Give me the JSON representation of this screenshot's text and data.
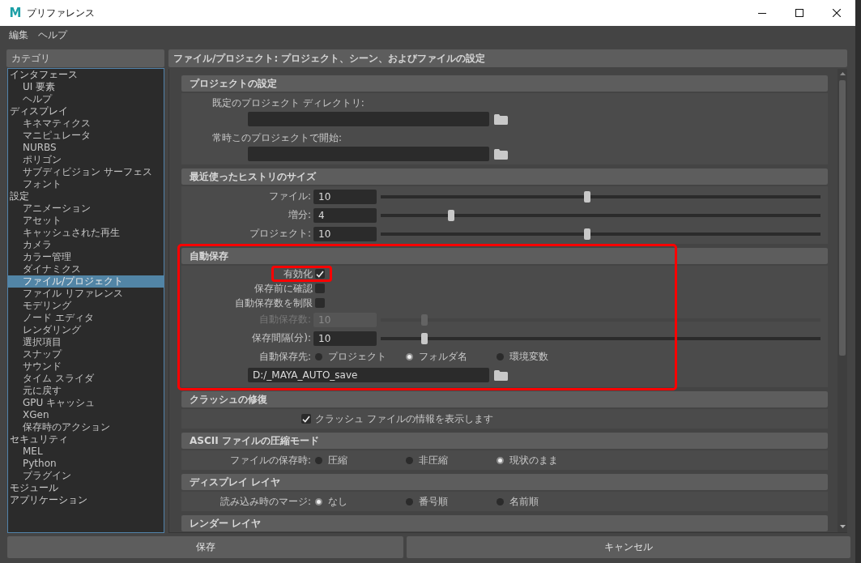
{
  "window": {
    "app_icon": "M",
    "title": "プリファレンス"
  },
  "menu": [
    {
      "label": "編集"
    },
    {
      "label": "ヘルプ"
    }
  ],
  "sidebar": {
    "title": "カテゴリ",
    "items": [
      {
        "label": "インタフェース",
        "selected": false,
        "children": [
          {
            "label": "UI 要素",
            "selected": false
          },
          {
            "label": "ヘルプ",
            "selected": false
          }
        ]
      },
      {
        "label": "ディスプレイ",
        "selected": false,
        "children": [
          {
            "label": "キネマティクス",
            "selected": false
          },
          {
            "label": "マニピュレータ",
            "selected": false
          },
          {
            "label": "NURBS",
            "selected": false
          },
          {
            "label": "ポリゴン",
            "selected": false
          },
          {
            "label": "サブディビジョン サーフェス",
            "selected": false
          },
          {
            "label": "フォント",
            "selected": false
          }
        ]
      },
      {
        "label": "設定",
        "selected": false,
        "children": [
          {
            "label": "アニメーション",
            "selected": false
          },
          {
            "label": "アセット",
            "selected": false
          },
          {
            "label": "キャッシュされた再生",
            "selected": false
          },
          {
            "label": "カメラ",
            "selected": false
          },
          {
            "label": "カラー管理",
            "selected": false
          },
          {
            "label": "ダイナミクス",
            "selected": false
          },
          {
            "label": "ファイル/プロジェクト",
            "selected": true
          },
          {
            "label": "ファイル リファレンス",
            "selected": false
          },
          {
            "label": "モデリング",
            "selected": false
          },
          {
            "label": "ノード エディタ",
            "selected": false
          },
          {
            "label": "レンダリング",
            "selected": false
          },
          {
            "label": "選択項目",
            "selected": false
          },
          {
            "label": "スナップ",
            "selected": false
          },
          {
            "label": "サウンド",
            "selected": false
          },
          {
            "label": "タイム スライダ",
            "selected": false
          },
          {
            "label": "元に戻す",
            "selected": false
          },
          {
            "label": "GPU キャッシュ",
            "selected": false
          },
          {
            "label": "XGen",
            "selected": false
          },
          {
            "label": "保存時のアクション",
            "selected": false
          }
        ]
      },
      {
        "label": "セキュリティ",
        "selected": false,
        "children": [
          {
            "label": "MEL",
            "selected": false
          },
          {
            "label": "Python",
            "selected": false
          },
          {
            "label": "プラグイン",
            "selected": false
          }
        ]
      },
      {
        "label": "モジュール",
        "selected": false
      },
      {
        "label": "アプリケーション",
        "selected": false
      }
    ]
  },
  "panel": {
    "title": "ファイル/プロジェクト: プロジェクト、シーン、およびファイルの設定",
    "sections": [
      {
        "title": "プロジェクトの設定",
        "highlighted": false,
        "rows": [
          {
            "kind": "path",
            "label": "既定のプロジェクト ディレクトリ:"
          },
          {
            "kind": "path",
            "label": "常時このプロジェクトで開始:"
          }
        ]
      },
      {
        "title": "最近使ったヒストリのサイズ",
        "highlighted": false,
        "rows": [
          {
            "kind": "slider",
            "label": "ファイル:",
            "value": "10",
            "level": 0.47,
            "disabled": false
          },
          {
            "kind": "slider",
            "label": "増分:",
            "value": "4",
            "level": 0.16,
            "disabled": false
          },
          {
            "kind": "slider",
            "label": "プロジェクト:",
            "value": "10",
            "level": 0.47,
            "disabled": false
          }
        ]
      },
      {
        "title": "自動保存",
        "highlighted": true,
        "rows": [
          {
            "kind": "checkbox",
            "label": "有効化",
            "checked": true,
            "highlighted": true
          },
          {
            "kind": "checkbox",
            "label": "保存前に確認",
            "checked": false,
            "highlighted": false
          },
          {
            "kind": "checkbox",
            "label": "自動保存数を制限",
            "checked": false,
            "highlighted": false
          },
          {
            "kind": "slider",
            "label": "自動保存数:",
            "value": "10",
            "level": 0.1,
            "disabled": true
          },
          {
            "kind": "slider",
            "label": "保存間隔(分):",
            "value": "10",
            "level": 0.1,
            "disabled": false
          },
          {
            "kind": "radio",
            "label": "自動保存先:",
            "options": [
              {
                "label": "プロジェクト",
                "selected": false
              },
              {
                "label": "フォルダ名",
                "selected": true
              },
              {
                "label": "環境変数",
                "selected": false
              }
            ]
          },
          {
            "kind": "path",
            "value": "D:/_MAYA_AUTO_save"
          }
        ]
      },
      {
        "title": "クラッシュの修復",
        "highlighted": false,
        "rows": [
          {
            "kind": "option",
            "label": "クラッシュ ファイルの情報を表示します",
            "checked": true
          }
        ]
      },
      {
        "title": "ASCII ファイルの圧縮モード",
        "highlighted": false,
        "rows": [
          {
            "kind": "radio",
            "label": "ファイルの保存時:",
            "options": [
              {
                "label": "圧縮",
                "selected": false
              },
              {
                "label": "非圧縮",
                "selected": false
              },
              {
                "label": "現状のまま",
                "selected": true
              }
            ]
          }
        ]
      },
      {
        "title": "ディスプレイ レイヤ",
        "highlighted": false,
        "rows": [
          {
            "kind": "radio",
            "label": "読み込み時のマージ:",
            "options": [
              {
                "label": "なし",
                "selected": true
              },
              {
                "label": "番号順",
                "selected": false
              },
              {
                "label": "名前順",
                "selected": false
              }
            ]
          }
        ]
      },
      {
        "title": "レンダー レイヤ",
        "highlighted": false
      }
    ]
  },
  "buttons": [
    {
      "label": "保存"
    },
    {
      "label": "キャンセル"
    }
  ]
}
